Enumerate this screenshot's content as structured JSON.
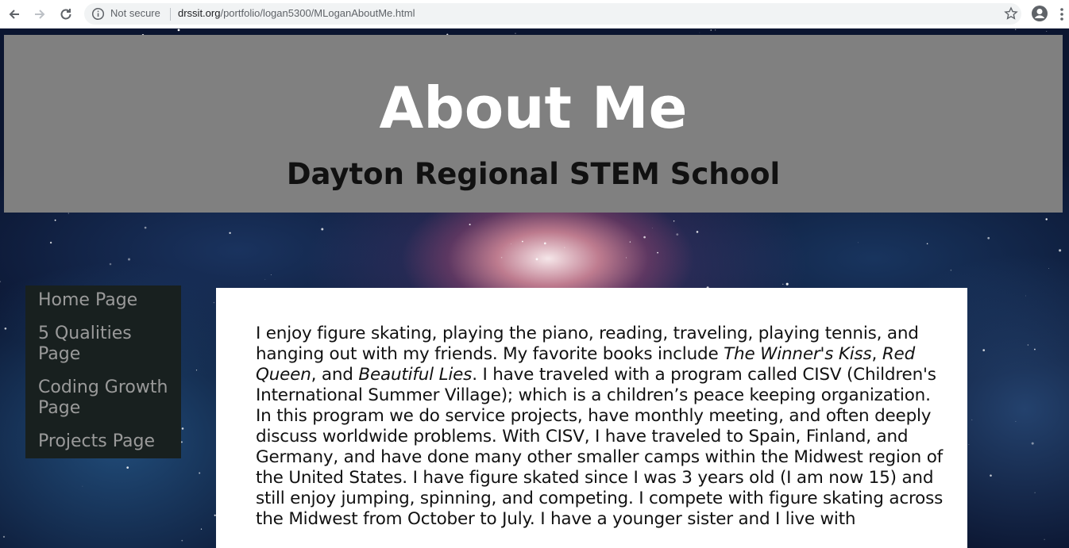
{
  "browser": {
    "security_label": "Not secure",
    "url_host": "drssit.org",
    "url_path": "/portfolio/logan5300/MLoganAboutMe.html"
  },
  "header": {
    "title": "About Me",
    "subtitle": "Dayton Regional STEM School"
  },
  "sidebar": {
    "items": [
      {
        "label": "Home Page"
      },
      {
        "label": "5 Qualities Page"
      },
      {
        "label": "Coding Growth Page"
      },
      {
        "label": "Projects Page"
      }
    ]
  },
  "content": {
    "part1": "I enjoy figure skating, playing the piano, reading, traveling, playing tennis, and hanging out with my friends. My favorite books include ",
    "book1": "The Winner's Kiss",
    "sep1": ", ",
    "book2": "Red Queen",
    "sep2": ", and ",
    "book3": "Beautiful Lies",
    "part2": ". I have traveled with a program called CISV (Children's International Summer Village); which is a children’s peace keeping organization. In this program we do service projects, have monthly meeting, and often deeply discuss worldwide problems. With CISV, I have traveled to Spain, Finland, and Germany, and have done many other smaller camps within the Midwest region of the United States. I have figure skated since I was 3 years old (I am now 15) and still enjoy jumping, spinning, and competing. I compete with figure skating across the Midwest from October to July. I have a younger sister and I live with"
  },
  "colors": {
    "header_bg": "#808080",
    "sidebar_bg": "#18201f",
    "nav_text": "#9a9a9a"
  }
}
